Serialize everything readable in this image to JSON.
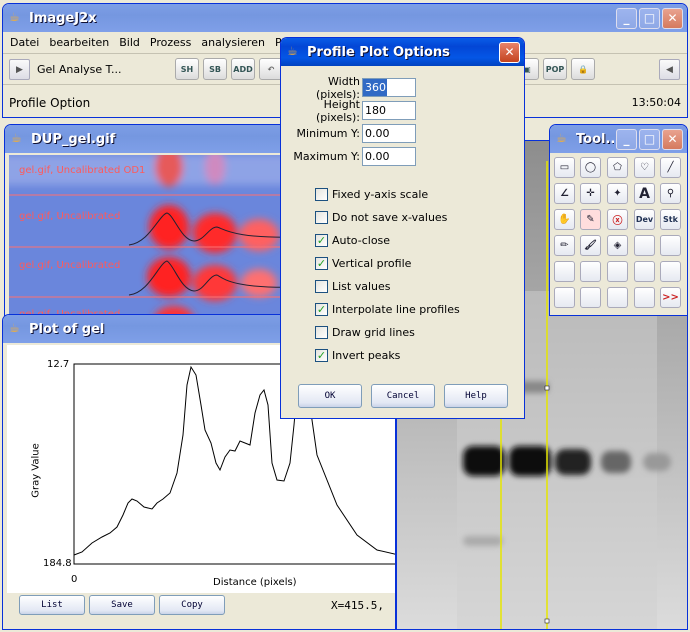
{
  "main": {
    "title": "ImageJ2x",
    "menu": [
      "Datei",
      "bearbeiten",
      "Bild",
      "Prozess",
      "analysieren",
      "Plugi"
    ],
    "macro_label": "Gel Analyse T...",
    "tools": [
      "SH",
      "SB",
      "ADD",
      "POP"
    ],
    "status": "Profile Option",
    "time": "13:50:04"
  },
  "gel_window": {
    "title": "DUP_gel.gif",
    "lane_labels": [
      "gel.gif, Uncalibrated OD1",
      "gel.gif, Uncalibrated",
      "gel.gif, Uncalibrated",
      "gel.gif, Uncalibrated"
    ]
  },
  "plot_window": {
    "title": "Plot of gel",
    "y_max": "12.7",
    "y_min": "184.8",
    "x_min": "0",
    "ylabel": "Gray Value",
    "xlabel": "Distance (pixels)",
    "buttons": [
      "List",
      "Save",
      "Copy"
    ],
    "readout": "X=415.5,"
  },
  "tool_window": {
    "title": "Tool...",
    "labels": {
      "text": "A",
      "dev": "Dev",
      "stk": "Stk",
      "more": ">>"
    }
  },
  "dialog": {
    "title": "Profile Plot Options",
    "fields": [
      {
        "label": "Width (pixels):",
        "value": "360"
      },
      {
        "label": "Height (pixels):",
        "value": "180"
      },
      {
        "label": "Minimum Y:",
        "value": "0.00"
      },
      {
        "label": "Maximum Y:",
        "value": "0.00"
      }
    ],
    "checks": [
      {
        "label": "Fixed y-axis scale",
        "checked": false
      },
      {
        "label": "Do not save x-values",
        "checked": false
      },
      {
        "label": "Auto-close",
        "checked": true
      },
      {
        "label": "Vertical profile",
        "checked": true
      },
      {
        "label": "List values",
        "checked": false
      },
      {
        "label": "Interpolate line profiles",
        "checked": true
      },
      {
        "label": "Draw grid lines",
        "checked": false
      },
      {
        "label": "Invert peaks",
        "checked": true
      }
    ],
    "buttons": {
      "ok": "OK",
      "cancel": "Cancel",
      "help": "Help"
    }
  }
}
